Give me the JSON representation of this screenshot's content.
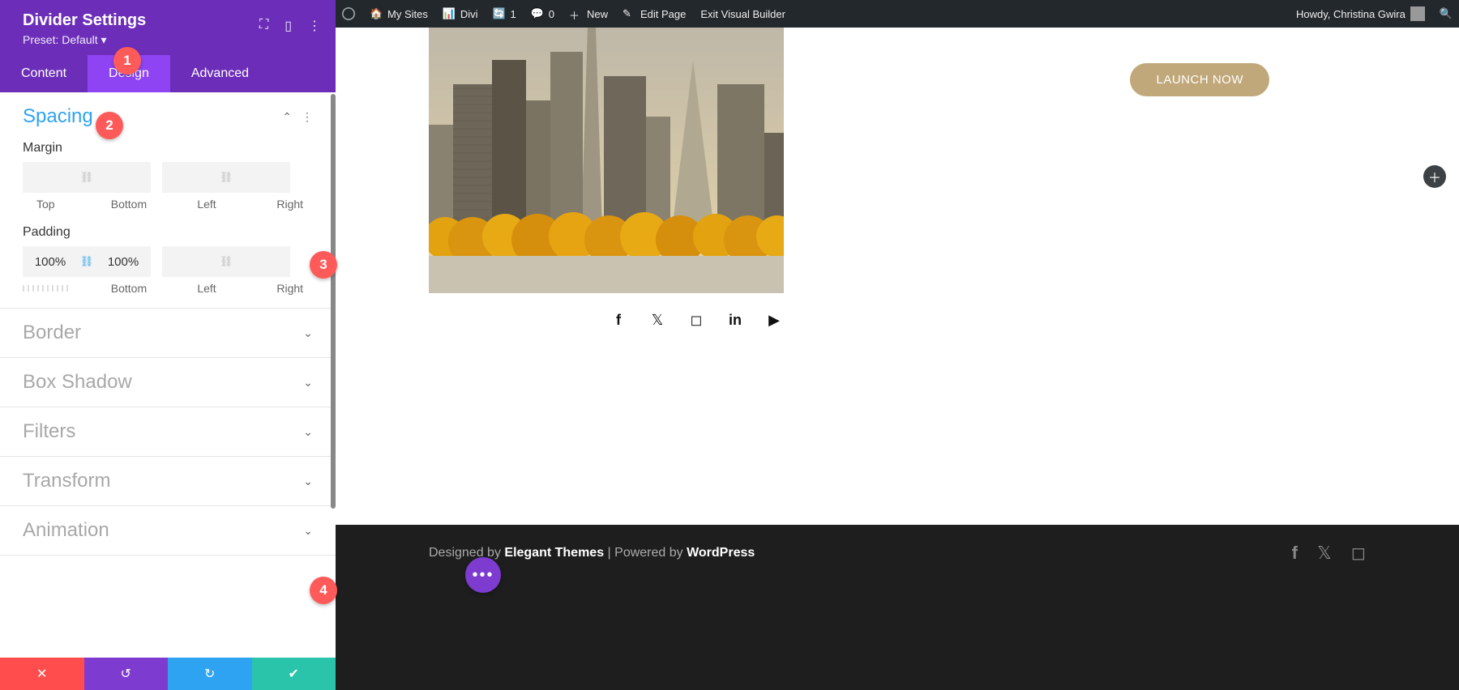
{
  "panel": {
    "title": "Divider Settings",
    "preset": "Preset: Default ▾",
    "tabs": {
      "content": "Content",
      "design": "Design",
      "advanced": "Advanced"
    }
  },
  "spacing": {
    "title": "Spacing",
    "margin_label": "Margin",
    "padding_label": "Padding",
    "margin": {
      "top": "",
      "bottom": "",
      "left": "",
      "right": ""
    },
    "padding": {
      "top": "100%",
      "bottom": "100%",
      "left": "",
      "right": ""
    },
    "sides": {
      "top": "Top",
      "bottom": "Bottom",
      "left": "Left",
      "right": "Right"
    }
  },
  "sections": {
    "border": "Border",
    "box_shadow": "Box Shadow",
    "filters": "Filters",
    "transform": "Transform",
    "animation": "Animation"
  },
  "admin": {
    "my_sites": "My Sites",
    "site_name": "Divi",
    "updates": "1",
    "comments": "0",
    "new": "New",
    "edit_page": "Edit Page",
    "exit_vb": "Exit Visual Builder",
    "howdy": "Howdy, Christina Gwira"
  },
  "page": {
    "launch": "LAUNCH NOW"
  },
  "footer": {
    "designed_by": "Designed by ",
    "theme": "Elegant Themes",
    "sep": " | Powered by ",
    "platform": "WordPress"
  },
  "badges": {
    "b1": "1",
    "b2": "2",
    "b3": "3",
    "b4": "4"
  }
}
